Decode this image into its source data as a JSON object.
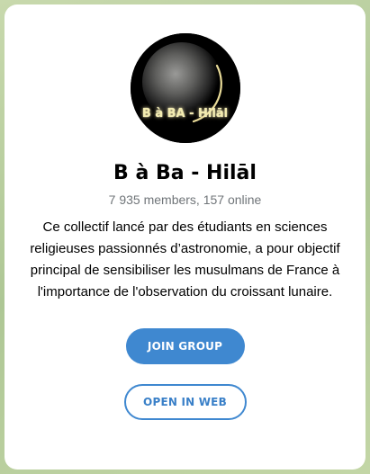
{
  "channel": {
    "avatar_caption": "B à BA - Hilāl",
    "title": "B à Ba - Hilāl",
    "stats": "7 935 members, 157 online",
    "description": "Ce collectif lancé par des étudiants en sciences religieuses passionnés d’astronomie, a pour objectif principal de sensibiliser les musulmans de France à l'importance de l'observation du croissant lunaire."
  },
  "actions": {
    "join_label": "JOIN GROUP",
    "web_label": "OPEN IN WEB"
  },
  "colors": {
    "accent": "#3f88d0",
    "muted_text": "#707579",
    "background": "#b9cfa3"
  }
}
